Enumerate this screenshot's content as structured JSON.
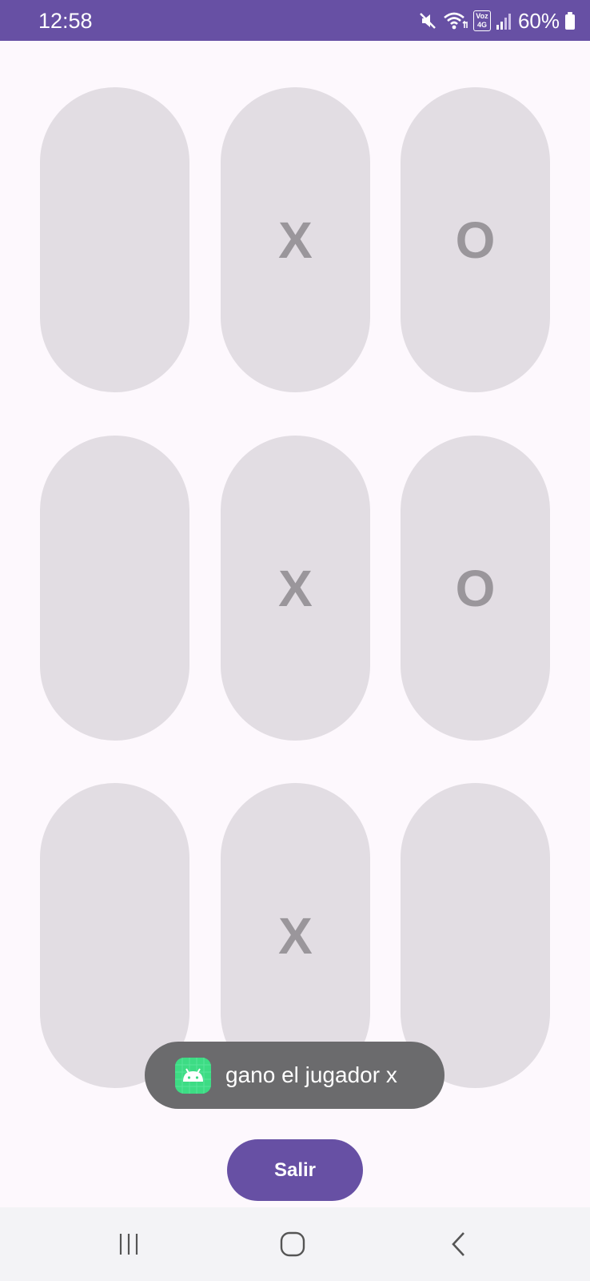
{
  "status_bar": {
    "time": "12:58",
    "volte_top": "Voz",
    "volte_bottom": "4G",
    "battery": "60%",
    "icons": [
      "mute-icon",
      "wifi-icon",
      "volte-icon",
      "signal-icon",
      "battery-icon"
    ]
  },
  "board": {
    "cells": [
      "",
      "X",
      "O",
      "",
      "X",
      "O",
      "",
      "X",
      ""
    ]
  },
  "toast": {
    "message": "gano el jugador x",
    "icon": "android-icon"
  },
  "exit_button": {
    "label": "Salir"
  },
  "nav_bar": {
    "icons": [
      "recent-apps-icon",
      "home-icon",
      "back-icon"
    ]
  },
  "colors": {
    "primary": "#6750a4",
    "background": "#fdf8fd",
    "cell": "#e2dde3",
    "cell_text": "#9a969b",
    "toast": "#6b6b6d",
    "android_green": "#3ddc84"
  }
}
